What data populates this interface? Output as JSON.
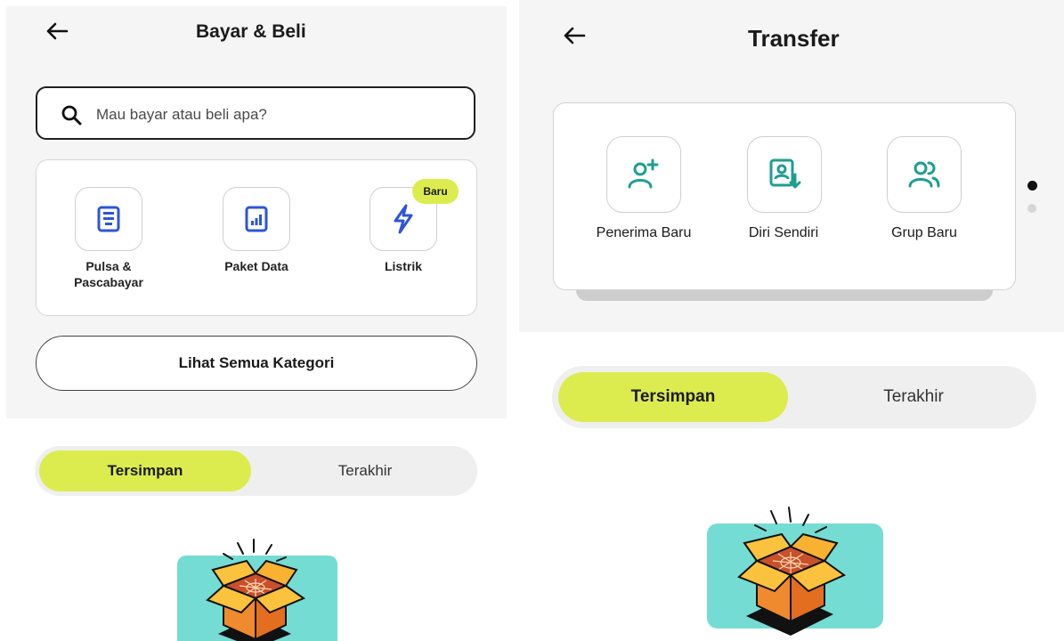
{
  "left": {
    "title": "Bayar & Beli",
    "search_placeholder": "Mau bayar atau beli apa?",
    "categories": [
      {
        "label": "Pulsa & Pascabayar",
        "icon": "document-icon"
      },
      {
        "label": "Paket Data",
        "icon": "data-chart-icon"
      },
      {
        "label": "Listrik",
        "icon": "lightning-icon",
        "badge": "Baru"
      }
    ],
    "see_all_label": "Lihat Semua Kategori",
    "tabs": {
      "active": "Tersimpan",
      "inactive": "Terakhir"
    }
  },
  "right": {
    "title": "Transfer",
    "options": [
      {
        "label": "Penerima Baru",
        "icon": "add-user-icon"
      },
      {
        "label": "Diri Sendiri",
        "icon": "self-transfer-icon"
      },
      {
        "label": "Grup Baru",
        "icon": "group-icon"
      }
    ],
    "tabs": {
      "active": "Tersimpan",
      "inactive": "Terakhir"
    },
    "pager": {
      "pages": 2,
      "current": 1
    }
  },
  "colors": {
    "accent": "#DCEC4F",
    "icon_blue": "#2D55D8",
    "icon_teal": "#1E9E91",
    "illustration_bg": "#74DCD2",
    "box_orange": "#F08A2E",
    "box_yellow": "#FBC23E"
  }
}
